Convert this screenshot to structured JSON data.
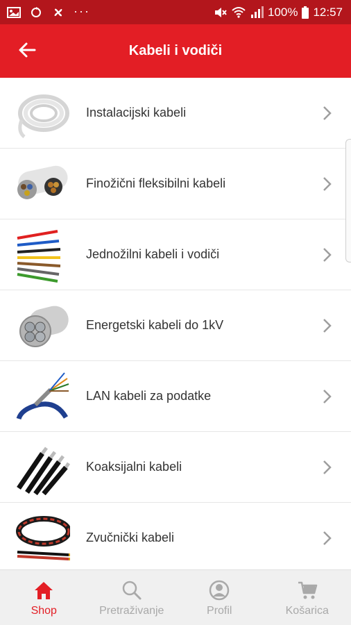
{
  "status_bar": {
    "battery": "100%",
    "time": "12:57",
    "left_icons": [
      "image-icon",
      "recycle-icon",
      "fan-icon",
      "more-dots-icon"
    ],
    "right_icons": [
      "mute-icon",
      "wifi-icon",
      "signal-icon",
      "battery-icon"
    ]
  },
  "app_bar": {
    "title": "Kabeli i vodiči",
    "back_icon": "arrow-left-icon"
  },
  "categories": [
    {
      "label": "Instalacijski kabeli",
      "thumb": "white-cable-coil"
    },
    {
      "label": "Finožični fleksibilni kabeli",
      "thumb": "flexible-cable-cross-section"
    },
    {
      "label": "Jednožilni kabeli i vodiči",
      "thumb": "colored-single-wires"
    },
    {
      "label": "Energetski kabeli do 1kV",
      "thumb": "power-cable-cross-section"
    },
    {
      "label": "LAN kabeli za podatke",
      "thumb": "lan-cable"
    },
    {
      "label": "Koaksijalni kabeli",
      "thumb": "coaxial-cables"
    },
    {
      "label": "Zvučnički kabeli",
      "thumb": "speaker-cable-roll"
    }
  ],
  "bottom_nav": [
    {
      "label": "Shop",
      "icon": "home-icon",
      "active": true
    },
    {
      "label": "Pretraživanje",
      "icon": "search-icon",
      "active": false
    },
    {
      "label": "Profil",
      "icon": "profile-icon",
      "active": false
    },
    {
      "label": "Košarica",
      "icon": "cart-icon",
      "active": false
    }
  ],
  "colors": {
    "status_bar": "#b3161c",
    "primary": "#e31e25",
    "nav_background": "#f0f0f0",
    "nav_inactive": "#a9a9a9"
  }
}
